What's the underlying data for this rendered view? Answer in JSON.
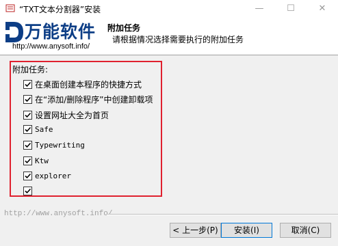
{
  "window": {
    "title": "“TXT文本分割器”安装"
  },
  "header": {
    "logo_text": "万能软件",
    "logo_url": "http://www.anysoft.info/",
    "title": "附加任务",
    "subtitle": "请根据情况选择需要执行的附加任务"
  },
  "tasks": {
    "label": "附加任务:",
    "items": [
      {
        "label": "在桌面创建本程序的快捷方式",
        "checked": true
      },
      {
        "label": "在“添加/删除程序”中创建卸载项",
        "checked": true
      },
      {
        "label": "设置网址大全为首页",
        "checked": true
      },
      {
        "label": "Safe",
        "checked": true
      },
      {
        "label": "Typewriting",
        "checked": true
      },
      {
        "label": "Ktw",
        "checked": true
      },
      {
        "label": "explorer",
        "checked": true
      },
      {
        "label": "",
        "checked": true
      }
    ]
  },
  "footer": {
    "url": "http://www.anysoft.info/"
  },
  "buttons": {
    "back": "< 上一步(P)",
    "install": "安装(I)",
    "cancel": "取消(C)"
  },
  "colors": {
    "highlight_border": "#e0202e",
    "logo_blue": "#0d3e86"
  },
  "icons": {
    "window": "installer-icon",
    "logo": "anysoft-logo-icon"
  }
}
